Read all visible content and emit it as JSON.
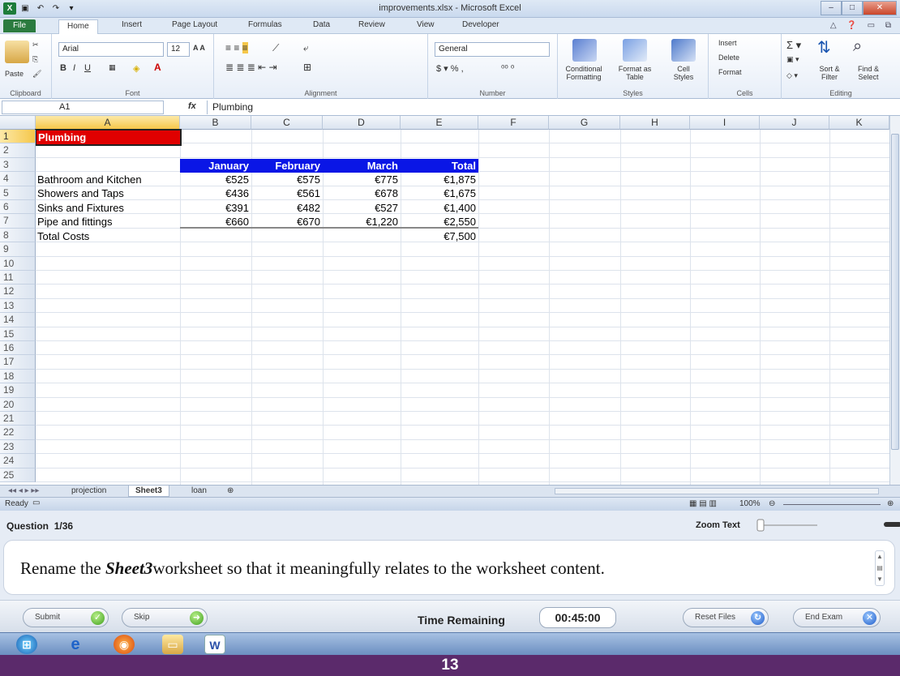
{
  "window": {
    "title": "improvements.xlsx - Microsoft Excel"
  },
  "ribbon": {
    "tabs": [
      "File",
      "Home",
      "Insert",
      "Page Layout",
      "Formulas",
      "Data",
      "Review",
      "View",
      "Developer"
    ],
    "groups": {
      "clipboard": "Clipboard",
      "font": "Font",
      "alignment": "Alignment",
      "number": "Number",
      "styles": "Styles",
      "cells": "Cells",
      "editing": "Editing"
    },
    "paste_label": "Paste",
    "font_name": "Arial",
    "font_size": "12",
    "number_format": "General",
    "conditional_formatting": "Conditional Formatting",
    "format_as_table": "Format as Table",
    "cell_styles": "Cell Styles",
    "insert": "Insert",
    "delete": "Delete",
    "format": "Format",
    "sort_filter": "Sort & Filter",
    "find_select": "Find & Select"
  },
  "formula_bar": {
    "name_box": "A1",
    "fx": "fx",
    "value": "Plumbing"
  },
  "grid": {
    "columns": [
      "A",
      "B",
      "C",
      "D",
      "E",
      "F",
      "G",
      "H",
      "I",
      "J",
      "K"
    ],
    "rows": [
      "1",
      "2",
      "3",
      "4",
      "5",
      "6",
      "7",
      "8",
      "9",
      "10",
      "11",
      "12",
      "13",
      "14",
      "15",
      "16",
      "17",
      "18",
      "19",
      "20",
      "21",
      "22",
      "23",
      "24",
      "25"
    ],
    "cells": {
      "A1": "Plumbing",
      "B3": "January",
      "C3": "February",
      "D3": "March",
      "E3": "Total",
      "A4": "Bathroom and Kitchen",
      "B4": "€525",
      "C4": "€575",
      "D4": "€775",
      "E4": "€1,875",
      "A5": "Showers and Taps",
      "B5": "€436",
      "C5": "€561",
      "D5": "€678",
      "E5": "€1,675",
      "A6": "Sinks and Fixtures",
      "B6": "€391",
      "C6": "€482",
      "D6": "€527",
      "E6": "€1,400",
      "A7": "Pipe and fittings",
      "B7": "€660",
      "C7": "€670",
      "D7": "€1,220",
      "E7": "€2,550",
      "A8": "Total Costs",
      "E8": "€7,500"
    }
  },
  "sheets": {
    "tabs": [
      "projection",
      "Sheet3",
      "loan"
    ],
    "active": "Sheet3"
  },
  "status": {
    "ready": "Ready",
    "zoom": "100%"
  },
  "exam": {
    "question_label": "Question",
    "question_counter": "1/36",
    "zoom_text_label": "Zoom Text",
    "question_prefix": "Rename the ",
    "question_emphasis": "Sheet3",
    "question_suffix": "worksheet so that it meaningfully relates to the worksheet content.",
    "submit": "Submit",
    "skip": "Skip",
    "time_remaining_label": "Time Remaining",
    "time_remaining": "00:45:00",
    "reset_files": "Reset Files",
    "end_exam": "End Exam"
  },
  "footer": {
    "page_number": "13"
  },
  "colors": {
    "accent_header": "#0a16e6",
    "selected_title": "#e00000",
    "footer_bg": "#5b2a6b"
  }
}
